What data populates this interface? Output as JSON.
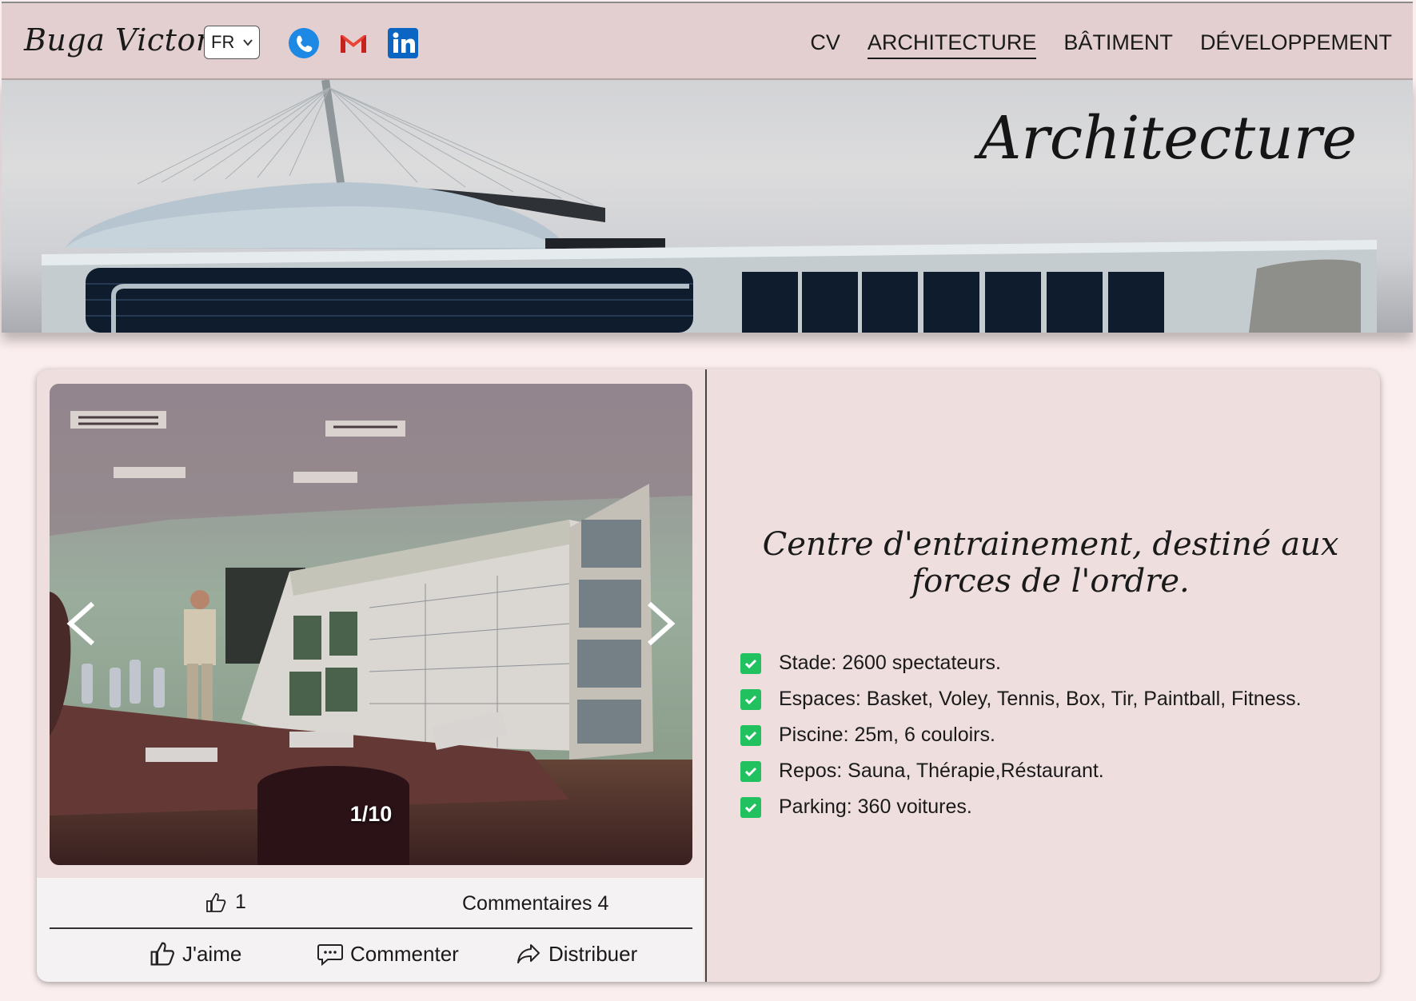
{
  "header": {
    "brand": "Buga Victor",
    "language": "FR",
    "social": {
      "phone": "phone-icon",
      "mail": "gmail-icon",
      "linkedin": "linkedin-icon"
    },
    "nav": [
      {
        "label": "CV",
        "active": false
      },
      {
        "label": "ARCHITECTURE",
        "active": true
      },
      {
        "label": "BÂTIMENT",
        "active": false
      },
      {
        "label": "DÉVELOPPEMENT",
        "active": false
      }
    ]
  },
  "hero": {
    "title": "Architecture"
  },
  "project": {
    "slide_counter": "1/10",
    "likes_count": "1",
    "comments_label": "Commentaires 4",
    "actions": {
      "like": "J'aime",
      "comment": "Commenter",
      "share": "Distribuer"
    },
    "description": "Centre d'entrainement, destiné aux forces de l'ordre.",
    "features": [
      "Stade: 2600 spectateurs.",
      "Espaces: Basket, Voley, Tennis, Box, Tir, Paintball, Fitness.",
      "Piscine: 25m, 6 couloirs.",
      "Repos: Sauna, Thérapie,Réstaurant.",
      "Parking: 360 voitures."
    ]
  },
  "colors": {
    "header_bg": "#e3cfcf",
    "page_bg": "#fbeeee",
    "card_bg": "#eedede",
    "check": "#21c15f",
    "phone": "#1e88e5",
    "gmail": "#ea4335",
    "linkedin": "#0a66c2"
  }
}
